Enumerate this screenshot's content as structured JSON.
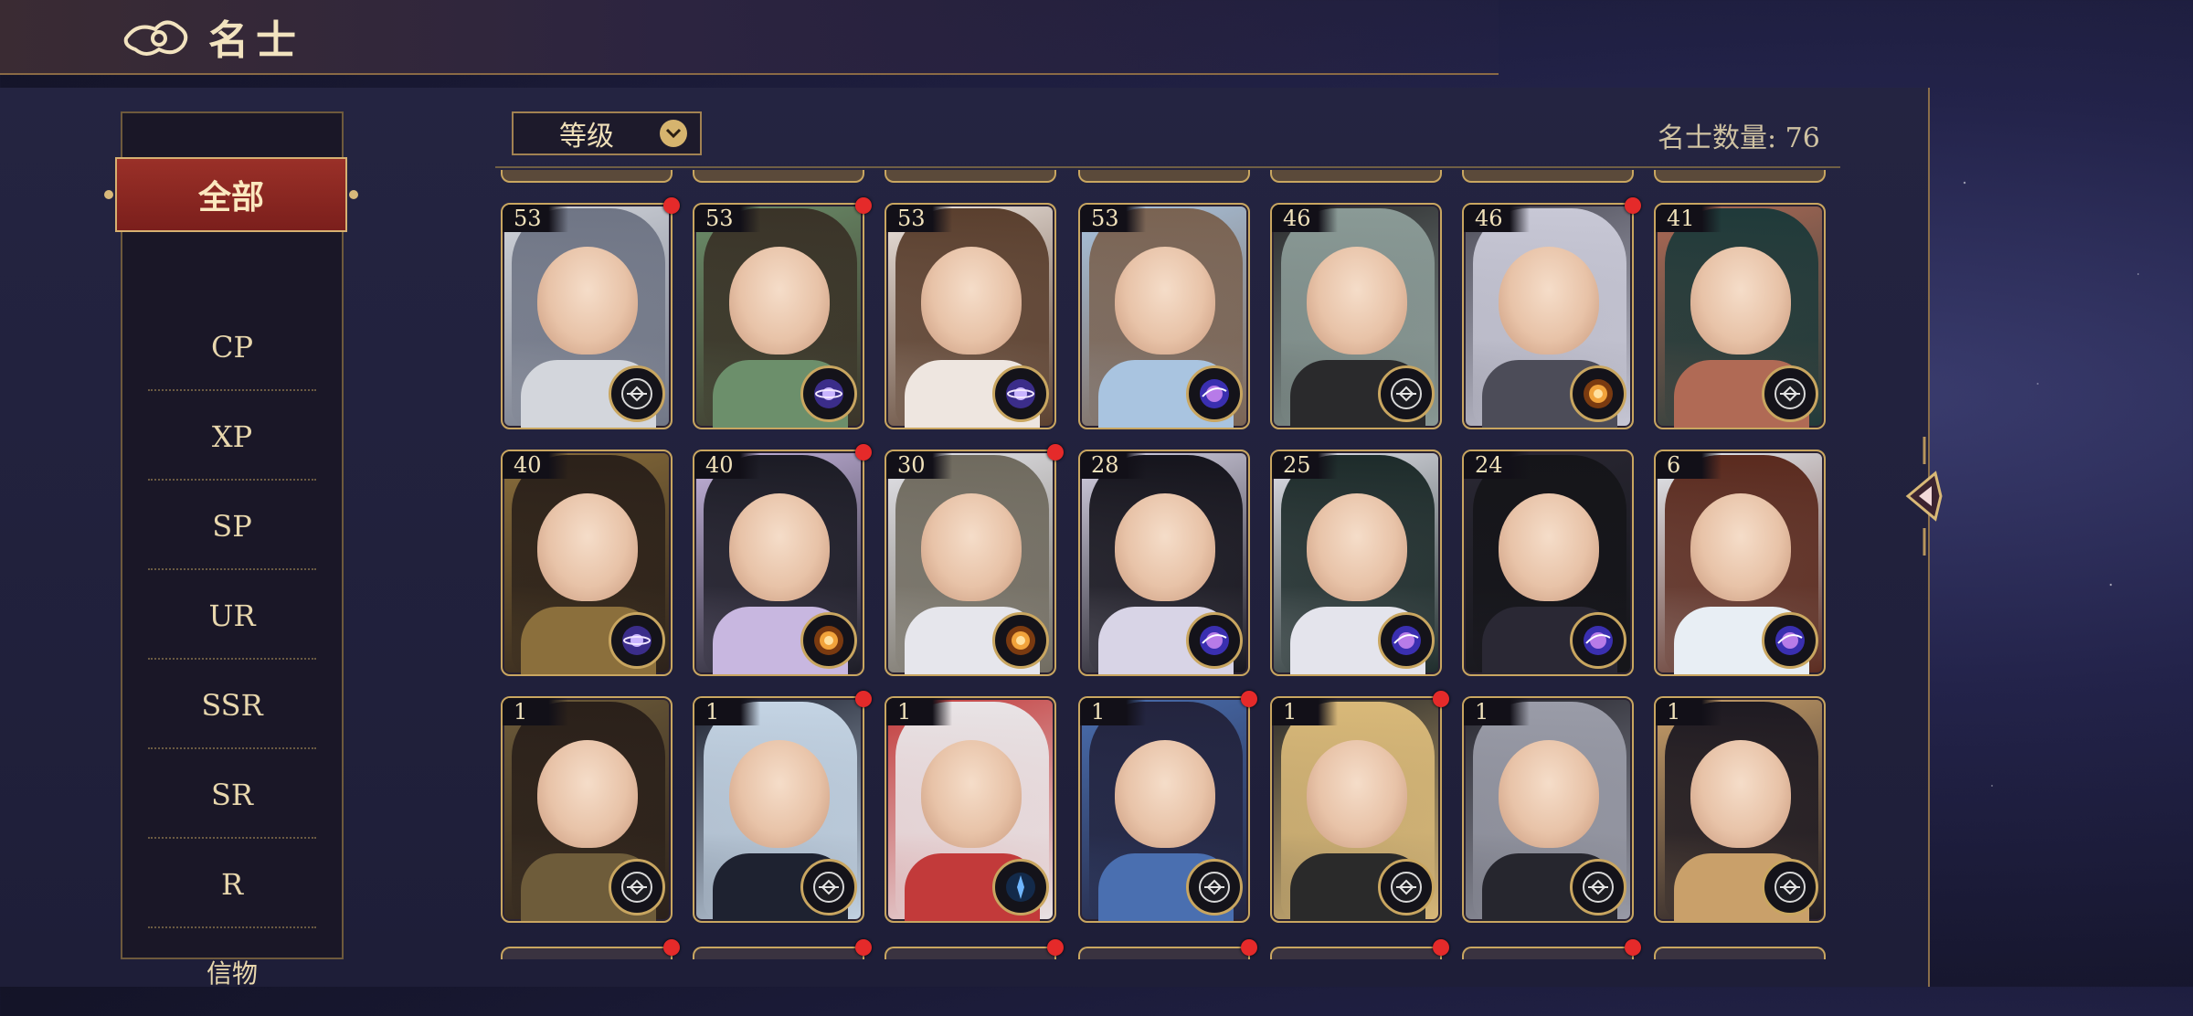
{
  "header": {
    "title": "名士"
  },
  "sidebar": {
    "active": "全部",
    "items": [
      "CP",
      "XP",
      "SP",
      "UR",
      "SSR",
      "SR",
      "R",
      "信物"
    ]
  },
  "toolbar": {
    "sort_label": "等级",
    "count_text": "名士数量: 76"
  },
  "colors": {
    "accent_gold": "#c9a660",
    "active_red": "#8e2923",
    "notification": "#e52a2a"
  },
  "cards": [
    {
      "level": "53",
      "badge": "swords-icon",
      "notif": true,
      "palette": [
        "#6f7585",
        "#d3d6dc"
      ]
    },
    {
      "level": "53",
      "badge": "planet-icon",
      "notif": true,
      "palette": [
        "#3a3328",
        "#6c8f6b"
      ]
    },
    {
      "level": "53",
      "badge": "planet-icon",
      "notif": false,
      "palette": [
        "#5a3f2e",
        "#eee6e0"
      ]
    },
    {
      "level": "53",
      "badge": "galaxy-icon",
      "notif": false,
      "palette": [
        "#7a6352",
        "#a9c4e0"
      ]
    },
    {
      "level": "46",
      "badge": "swords-icon",
      "notif": false,
      "palette": [
        "#8a9a96",
        "#2a2a2c"
      ]
    },
    {
      "level": "46",
      "badge": "sun-icon",
      "notif": true,
      "palette": [
        "#c8c8d6",
        "#4c4c58"
      ]
    },
    {
      "level": "41",
      "badge": "swords-icon",
      "notif": false,
      "palette": [
        "#1f3a3a",
        "#b06a55"
      ]
    },
    {
      "level": "40",
      "badge": "planet-icon",
      "notif": false,
      "palette": [
        "#2b211a",
        "#8b6f3c"
      ]
    },
    {
      "level": "40",
      "badge": "sun-icon",
      "notif": true,
      "palette": [
        "#1b1b24",
        "#c8b7e0"
      ]
    },
    {
      "level": "30",
      "badge": "sun-icon",
      "notif": true,
      "palette": [
        "#6f6a5e",
        "#e6e6ec"
      ]
    },
    {
      "level": "28",
      "badge": "galaxy-icon",
      "notif": false,
      "palette": [
        "#15141c",
        "#d8d4e6"
      ]
    },
    {
      "level": "25",
      "badge": "galaxy-icon",
      "notif": false,
      "palette": [
        "#1d2b2a",
        "#e4e4ec"
      ]
    },
    {
      "level": "24",
      "badge": "galaxy-icon",
      "notif": false,
      "palette": [
        "#151519",
        "#2a2834"
      ]
    },
    {
      "level": "6",
      "badge": "galaxy-icon",
      "notif": false,
      "palette": [
        "#5a2a1e",
        "#e8eef4"
      ]
    },
    {
      "level": "1",
      "badge": "swords-icon",
      "notif": false,
      "palette": [
        "#2a201a",
        "#6e5c3a"
      ]
    },
    {
      "level": "1",
      "badge": "swords-icon",
      "notif": true,
      "palette": [
        "#c4d4e4",
        "#1e2230"
      ]
    },
    {
      "level": "1",
      "badge": "compass-icon",
      "notif": false,
      "palette": [
        "#e8e4e6",
        "#c23a3a"
      ]
    },
    {
      "level": "1",
      "badge": "swords-icon",
      "notif": true,
      "palette": [
        "#23243e",
        "#4a6fb0"
      ]
    },
    {
      "level": "1",
      "badge": "swords-icon",
      "notif": true,
      "palette": [
        "#d9b979",
        "#2a2a2a"
      ]
    },
    {
      "level": "1",
      "badge": "swords-icon",
      "notif": false,
      "palette": [
        "#9a9ca8",
        "#26262e"
      ]
    },
    {
      "level": "1",
      "badge": "swords-icon",
      "notif": false,
      "palette": [
        "#1e1a22",
        "#c9a06a"
      ]
    }
  ]
}
